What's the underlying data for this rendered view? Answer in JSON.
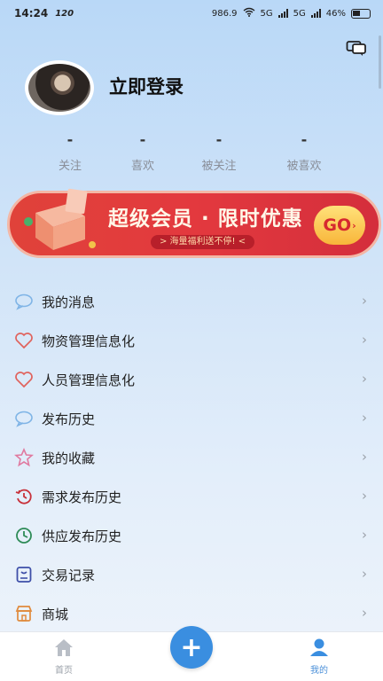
{
  "status_bar": {
    "time": "14:24",
    "network_speed": "120",
    "data_rate": "986.9",
    "signal_1": "5G",
    "signal_2": "5G",
    "battery": "46%"
  },
  "profile": {
    "login_label": "立即登录"
  },
  "stats": [
    {
      "value": "-",
      "label": "关注"
    },
    {
      "value": "-",
      "label": "喜欢"
    },
    {
      "value": "-",
      "label": "被关注"
    },
    {
      "value": "-",
      "label": "被喜欢"
    }
  ],
  "banner": {
    "title": "超级会员 · 限时优惠",
    "subtitle": "> 海量福利送不停! <",
    "go": "GO"
  },
  "menu": [
    {
      "label": "我的消息",
      "icon": "chat-bubble-icon"
    },
    {
      "label": "物资管理信息化",
      "icon": "heart-icon"
    },
    {
      "label": "人员管理信息化",
      "icon": "heart-icon"
    },
    {
      "label": "发布历史",
      "icon": "chat-bubble-icon"
    },
    {
      "label": "我的收藏",
      "icon": "star-icon"
    },
    {
      "label": "需求发布历史",
      "icon": "history-icon"
    },
    {
      "label": "供应发布历史",
      "icon": "clock-icon"
    },
    {
      "label": "交易记录",
      "icon": "receipt-icon"
    },
    {
      "label": "商城",
      "icon": "shop-icon"
    }
  ],
  "bottom_nav": {
    "home": "首页",
    "add": "+",
    "mine": "我的"
  },
  "colors": {
    "accent": "#3a8ee0",
    "banner_red": "#e0423a",
    "active_nav": "#4a8fd8"
  }
}
